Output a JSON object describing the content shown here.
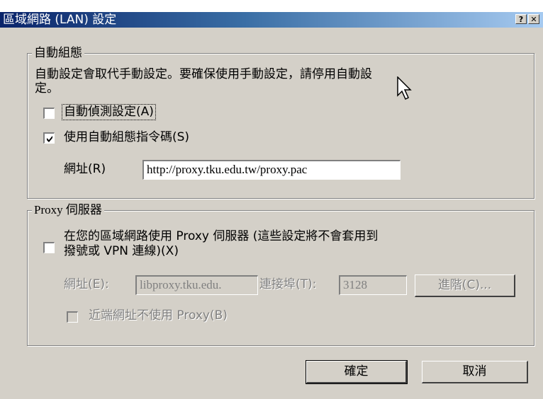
{
  "window": {
    "title": "區域網路 (LAN) 設定",
    "help_button": "?",
    "close_button": "✕"
  },
  "auto_config": {
    "group_label": "自動組態",
    "description_line1": "自動設定會取代手動設定。要確保使用手動設定，請停用自動設",
    "description_line2": "定。",
    "auto_detect_label": "自動偵測設定(A)",
    "auto_detect_checked": false,
    "use_script_label": "使用自動組態指令碼(S)",
    "use_script_checked": true,
    "address_label": "網址(R)",
    "address_value": "http://proxy.tku.edu.tw/proxy.pac"
  },
  "proxy": {
    "group_label": "Proxy 伺服器",
    "use_proxy_line1": "在您的區域網路使用 Proxy 伺服器 (這些設定將不會套用到",
    "use_proxy_line2": "撥號或 VPN 連線)(X)",
    "use_proxy_checked": false,
    "address_label": "網址(E):",
    "address_value": "libproxy.tku.edu.",
    "port_label": "連接埠(T):",
    "port_value": "3128",
    "advanced_button": "進階(C)...",
    "bypass_label": "近端網址不使用 Proxy(B)",
    "bypass_checked": false
  },
  "buttons": {
    "ok": "確定",
    "cancel": "取消"
  }
}
